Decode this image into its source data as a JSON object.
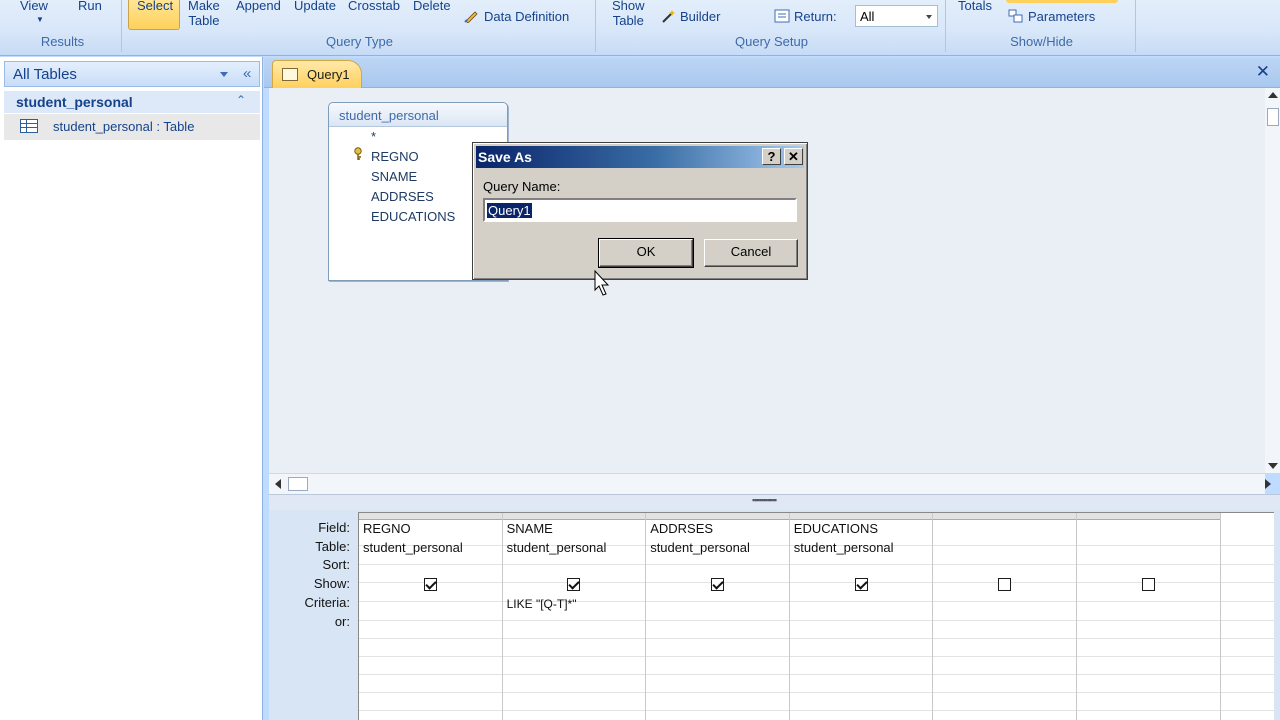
{
  "ribbon": {
    "view_label": "View",
    "run_label": "Run",
    "results_group": "Results",
    "select_label": "Select",
    "make_table_label_1": "Make",
    "make_table_label_2": "Table",
    "append_label": "Append",
    "update_label": "Update",
    "crosstab_label": "Crosstab",
    "delete_label": "Delete",
    "data_definition_label": "Data Definition",
    "query_type_group": "Query Type",
    "show_table_label_1": "Show",
    "show_table_label_2": "Table",
    "builder_label": "Builder",
    "return_label": "Return:",
    "return_value": "All",
    "query_setup_group": "Query Setup",
    "totals_label": "Totals",
    "parameters_label": "Parameters",
    "show_hide_group": "Show/Hide"
  },
  "nav": {
    "title": "All Tables",
    "collapse_glyph": "«",
    "group_label": "student_personal",
    "group_chevron": "⌃",
    "item_label": "student_personal : Table"
  },
  "document": {
    "tab_label": "Query1",
    "close_glyph": "✕"
  },
  "field_list": {
    "title": "student_personal",
    "fields": [
      "*",
      "REGNO",
      "SNAME",
      "ADDRSES",
      "EDUCATIONS"
    ]
  },
  "dialog": {
    "title": "Save As",
    "help_glyph": "?",
    "close_glyph": "✕",
    "field_label": "Query Name:",
    "field_value": "Query1",
    "ok_label": "OK",
    "cancel_label": "Cancel"
  },
  "grid": {
    "row_labels": [
      "Field:",
      "Table:",
      "Sort:",
      "Show:",
      "Criteria:",
      "or:"
    ],
    "columns": [
      {
        "field": "REGNO",
        "table": "student_personal",
        "show": true,
        "criteria": ""
      },
      {
        "field": "SNAME",
        "table": "student_personal",
        "show": true,
        "criteria": "LIKE \"[Q-T]*\""
      },
      {
        "field": "ADDRSES",
        "table": "student_personal",
        "show": true,
        "criteria": ""
      },
      {
        "field": "EDUCATIONS",
        "table": "student_personal",
        "show": true,
        "criteria": ""
      },
      {
        "field": "",
        "table": "",
        "show": false,
        "criteria": ""
      },
      {
        "field": "",
        "table": "",
        "show": false,
        "criteria": ""
      }
    ]
  },
  "colors": {
    "ribbon_text": "#15428b",
    "active_tab": "#ffd15b",
    "dialog_title": "#0a246a"
  }
}
